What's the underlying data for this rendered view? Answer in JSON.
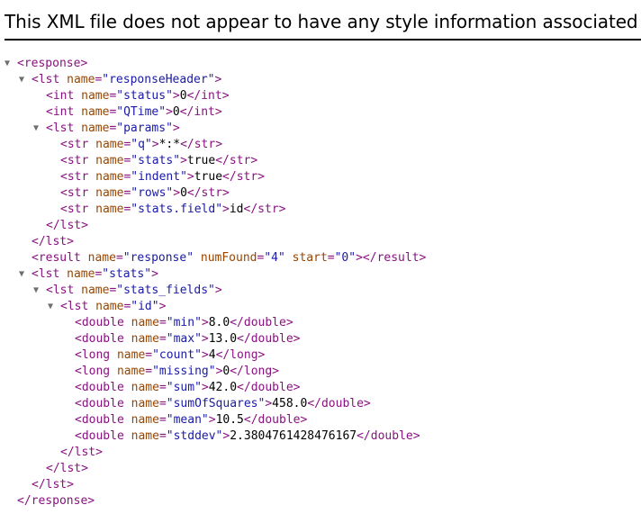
{
  "header": {
    "message": "This XML file does not appear to have any style information associated with it. The document tree is shown below."
  },
  "toggle_glyph": "▼",
  "colors": {
    "tag": "#881280",
    "attr_name": "#994500",
    "attr_value": "#1a1aa6",
    "text": "#000000"
  },
  "lines": [
    {
      "indent": 0,
      "toggle": true,
      "parts": [
        [
          "t",
          "<response>"
        ]
      ]
    },
    {
      "indent": 1,
      "toggle": true,
      "parts": [
        [
          "t",
          "<lst "
        ],
        [
          "an",
          "name"
        ],
        [
          "t",
          "="
        ],
        [
          "av",
          "\"responseHeader\""
        ],
        [
          "t",
          ">"
        ]
      ]
    },
    {
      "indent": 2,
      "toggle": false,
      "parts": [
        [
          "t",
          "<int "
        ],
        [
          "an",
          "name"
        ],
        [
          "t",
          "="
        ],
        [
          "av",
          "\"status\""
        ],
        [
          "t",
          ">"
        ],
        [
          "tx",
          "0"
        ],
        [
          "t",
          "</int>"
        ]
      ]
    },
    {
      "indent": 2,
      "toggle": false,
      "parts": [
        [
          "t",
          "<int "
        ],
        [
          "an",
          "name"
        ],
        [
          "t",
          "="
        ],
        [
          "av",
          "\"QTime\""
        ],
        [
          "t",
          ">"
        ],
        [
          "tx",
          "0"
        ],
        [
          "t",
          "</int>"
        ]
      ]
    },
    {
      "indent": 2,
      "toggle": true,
      "parts": [
        [
          "t",
          "<lst "
        ],
        [
          "an",
          "name"
        ],
        [
          "t",
          "="
        ],
        [
          "av",
          "\"params\""
        ],
        [
          "t",
          ">"
        ]
      ]
    },
    {
      "indent": 3,
      "toggle": false,
      "parts": [
        [
          "t",
          "<str "
        ],
        [
          "an",
          "name"
        ],
        [
          "t",
          "="
        ],
        [
          "av",
          "\"q\""
        ],
        [
          "t",
          ">"
        ],
        [
          "tx",
          "*:*"
        ],
        [
          "t",
          "</str>"
        ]
      ]
    },
    {
      "indent": 3,
      "toggle": false,
      "parts": [
        [
          "t",
          "<str "
        ],
        [
          "an",
          "name"
        ],
        [
          "t",
          "="
        ],
        [
          "av",
          "\"stats\""
        ],
        [
          "t",
          ">"
        ],
        [
          "tx",
          "true"
        ],
        [
          "t",
          "</str>"
        ]
      ]
    },
    {
      "indent": 3,
      "toggle": false,
      "parts": [
        [
          "t",
          "<str "
        ],
        [
          "an",
          "name"
        ],
        [
          "t",
          "="
        ],
        [
          "av",
          "\"indent\""
        ],
        [
          "t",
          ">"
        ],
        [
          "tx",
          "true"
        ],
        [
          "t",
          "</str>"
        ]
      ]
    },
    {
      "indent": 3,
      "toggle": false,
      "parts": [
        [
          "t",
          "<str "
        ],
        [
          "an",
          "name"
        ],
        [
          "t",
          "="
        ],
        [
          "av",
          "\"rows\""
        ],
        [
          "t",
          ">"
        ],
        [
          "tx",
          "0"
        ],
        [
          "t",
          "</str>"
        ]
      ]
    },
    {
      "indent": 3,
      "toggle": false,
      "parts": [
        [
          "t",
          "<str "
        ],
        [
          "an",
          "name"
        ],
        [
          "t",
          "="
        ],
        [
          "av",
          "\"stats.field\""
        ],
        [
          "t",
          ">"
        ],
        [
          "tx",
          "id"
        ],
        [
          "t",
          "</str>"
        ]
      ]
    },
    {
      "indent": 2,
      "toggle": false,
      "parts": [
        [
          "t",
          "</lst>"
        ]
      ]
    },
    {
      "indent": 1,
      "toggle": false,
      "parts": [
        [
          "t",
          "</lst>"
        ]
      ]
    },
    {
      "indent": 1,
      "toggle": false,
      "parts": [
        [
          "t",
          "<result "
        ],
        [
          "an",
          "name"
        ],
        [
          "t",
          "="
        ],
        [
          "av",
          "\"response\""
        ],
        [
          "t",
          " "
        ],
        [
          "an",
          "numFound"
        ],
        [
          "t",
          "="
        ],
        [
          "av",
          "\"4\""
        ],
        [
          "t",
          " "
        ],
        [
          "an",
          "start"
        ],
        [
          "t",
          "="
        ],
        [
          "av",
          "\"0\""
        ],
        [
          "t",
          "></result>"
        ]
      ]
    },
    {
      "indent": 1,
      "toggle": true,
      "parts": [
        [
          "t",
          "<lst "
        ],
        [
          "an",
          "name"
        ],
        [
          "t",
          "="
        ],
        [
          "av",
          "\"stats\""
        ],
        [
          "t",
          ">"
        ]
      ]
    },
    {
      "indent": 2,
      "toggle": true,
      "parts": [
        [
          "t",
          "<lst "
        ],
        [
          "an",
          "name"
        ],
        [
          "t",
          "="
        ],
        [
          "av",
          "\"stats_fields\""
        ],
        [
          "t",
          ">"
        ]
      ]
    },
    {
      "indent": 3,
      "toggle": true,
      "parts": [
        [
          "t",
          "<lst "
        ],
        [
          "an",
          "name"
        ],
        [
          "t",
          "="
        ],
        [
          "av",
          "\"id\""
        ],
        [
          "t",
          ">"
        ]
      ]
    },
    {
      "indent": 4,
      "toggle": false,
      "parts": [
        [
          "t",
          "<double "
        ],
        [
          "an",
          "name"
        ],
        [
          "t",
          "="
        ],
        [
          "av",
          "\"min\""
        ],
        [
          "t",
          ">"
        ],
        [
          "tx",
          "8.0"
        ],
        [
          "t",
          "</double>"
        ]
      ]
    },
    {
      "indent": 4,
      "toggle": false,
      "parts": [
        [
          "t",
          "<double "
        ],
        [
          "an",
          "name"
        ],
        [
          "t",
          "="
        ],
        [
          "av",
          "\"max\""
        ],
        [
          "t",
          ">"
        ],
        [
          "tx",
          "13.0"
        ],
        [
          "t",
          "</double>"
        ]
      ]
    },
    {
      "indent": 4,
      "toggle": false,
      "parts": [
        [
          "t",
          "<long "
        ],
        [
          "an",
          "name"
        ],
        [
          "t",
          "="
        ],
        [
          "av",
          "\"count\""
        ],
        [
          "t",
          ">"
        ],
        [
          "tx",
          "4"
        ],
        [
          "t",
          "</long>"
        ]
      ]
    },
    {
      "indent": 4,
      "toggle": false,
      "parts": [
        [
          "t",
          "<long "
        ],
        [
          "an",
          "name"
        ],
        [
          "t",
          "="
        ],
        [
          "av",
          "\"missing\""
        ],
        [
          "t",
          ">"
        ],
        [
          "tx",
          "0"
        ],
        [
          "t",
          "</long>"
        ]
      ]
    },
    {
      "indent": 4,
      "toggle": false,
      "parts": [
        [
          "t",
          "<double "
        ],
        [
          "an",
          "name"
        ],
        [
          "t",
          "="
        ],
        [
          "av",
          "\"sum\""
        ],
        [
          "t",
          ">"
        ],
        [
          "tx",
          "42.0"
        ],
        [
          "t",
          "</double>"
        ]
      ]
    },
    {
      "indent": 4,
      "toggle": false,
      "parts": [
        [
          "t",
          "<double "
        ],
        [
          "an",
          "name"
        ],
        [
          "t",
          "="
        ],
        [
          "av",
          "\"sumOfSquares\""
        ],
        [
          "t",
          ">"
        ],
        [
          "tx",
          "458.0"
        ],
        [
          "t",
          "</double>"
        ]
      ]
    },
    {
      "indent": 4,
      "toggle": false,
      "parts": [
        [
          "t",
          "<double "
        ],
        [
          "an",
          "name"
        ],
        [
          "t",
          "="
        ],
        [
          "av",
          "\"mean\""
        ],
        [
          "t",
          ">"
        ],
        [
          "tx",
          "10.5"
        ],
        [
          "t",
          "</double>"
        ]
      ]
    },
    {
      "indent": 4,
      "toggle": false,
      "parts": [
        [
          "t",
          "<double "
        ],
        [
          "an",
          "name"
        ],
        [
          "t",
          "="
        ],
        [
          "av",
          "\"stddev\""
        ],
        [
          "t",
          ">"
        ],
        [
          "tx",
          "2.3804761428476167"
        ],
        [
          "t",
          "</double>"
        ]
      ]
    },
    {
      "indent": 3,
      "toggle": false,
      "parts": [
        [
          "t",
          "</lst>"
        ]
      ]
    },
    {
      "indent": 2,
      "toggle": false,
      "parts": [
        [
          "t",
          "</lst>"
        ]
      ]
    },
    {
      "indent": 1,
      "toggle": false,
      "parts": [
        [
          "t",
          "</lst>"
        ]
      ]
    },
    {
      "indent": 0,
      "toggle": false,
      "parts": [
        [
          "t",
          "</response>"
        ]
      ]
    }
  ]
}
